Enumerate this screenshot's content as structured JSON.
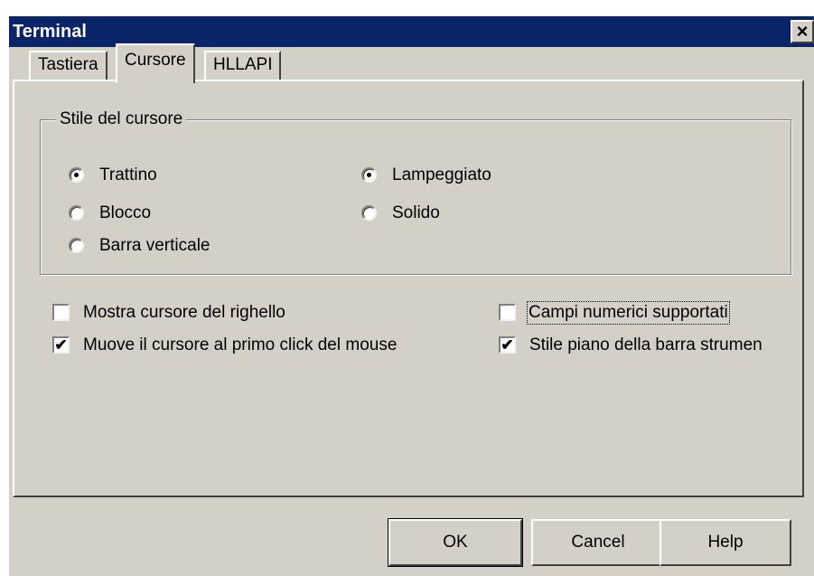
{
  "window": {
    "title": "Terminal",
    "close_label": "×"
  },
  "tabs": [
    {
      "label": "Tastiera",
      "active": false
    },
    {
      "label": "Cursore",
      "active": true
    },
    {
      "label": "HLLAPI",
      "active": false
    }
  ],
  "cursor_style_group": {
    "title": "Stile del cursore",
    "shape_options": [
      {
        "label": "Trattino",
        "selected": true
      },
      {
        "label": "Blocco",
        "selected": false
      },
      {
        "label": "Barra verticale",
        "selected": false
      }
    ],
    "blink_options": [
      {
        "label": "Lampeggiato",
        "selected": true
      },
      {
        "label": "Solido",
        "selected": false
      }
    ]
  },
  "options": {
    "show_ruler_cursor": {
      "label": "Mostra cursore del righello",
      "checked": false
    },
    "move_cursor_first_click": {
      "label": "Muove il cursore al primo click del mouse",
      "checked": true
    },
    "numeric_fields_supported": {
      "label": "Campi numerici supportati",
      "checked": false
    },
    "flat_toolbar_style": {
      "label": "Stile piano della barra strumen",
      "checked": true
    }
  },
  "buttons": {
    "ok": "OK",
    "cancel": "Cancel",
    "help": "Help"
  },
  "colors": {
    "titlebar": "#0a246a",
    "face": "#d4d0c8"
  }
}
